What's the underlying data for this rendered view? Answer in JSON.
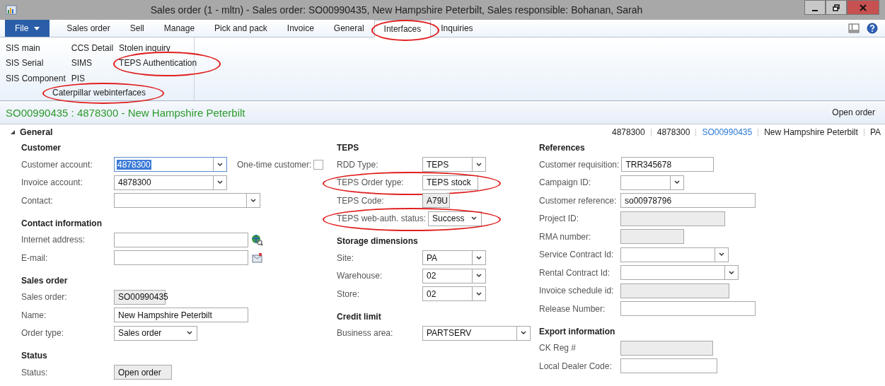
{
  "window": {
    "title": "Sales order (1 - mltn) - Sales order: SO00990435, New Hampshire Peterbilt, Sales responsible: Bohanan, Sarah"
  },
  "file_menu": {
    "label": "File"
  },
  "tabs": [
    {
      "label": "Sales order",
      "selected": false,
      "circled": false
    },
    {
      "label": "Sell",
      "selected": false,
      "circled": false
    },
    {
      "label": "Manage",
      "selected": false,
      "circled": false
    },
    {
      "label": "Pick and pack",
      "selected": false,
      "circled": false
    },
    {
      "label": "Invoice",
      "selected": false,
      "circled": false
    },
    {
      "label": "General",
      "selected": false,
      "circled": false
    },
    {
      "label": "Interfaces",
      "selected": true,
      "circled": true
    },
    {
      "label": "Inquiries",
      "selected": false,
      "circled": false
    }
  ],
  "ribbon": {
    "columns": [
      [
        {
          "label": "SIS main",
          "circled": false
        },
        {
          "label": "SIS Serial",
          "circled": false
        },
        {
          "label": "SIS Component",
          "circled": false
        }
      ],
      [
        {
          "label": "CCS Detail",
          "circled": false
        },
        {
          "label": "SIMS",
          "circled": false
        },
        {
          "label": "PIS",
          "circled": false
        }
      ],
      [
        {
          "label": "Stolen inquiry",
          "circled": false
        },
        {
          "label": "TEPS Authentication",
          "circled": true
        }
      ]
    ],
    "group_label": {
      "label": "Caterpillar webinterfaces",
      "circled": true
    }
  },
  "header": {
    "title": "SO00990435 : 4878300 - New Hampshire Peterbilt",
    "status": "Open order"
  },
  "fasttab": {
    "title": "General",
    "expanded": true,
    "summary": [
      {
        "text": "4878300",
        "kind": "plain"
      },
      {
        "text": "4878300",
        "kind": "plain"
      },
      {
        "text": "SO00990435",
        "kind": "link"
      },
      {
        "text": "New Hampshire Peterbilt",
        "kind": "plain"
      },
      {
        "text": "PA",
        "kind": "plain"
      }
    ]
  },
  "columns": [
    [
      {
        "title": "Customer",
        "fields": [
          {
            "label": "Customer account:",
            "kind": "combo",
            "value": "4878300",
            "focused": true,
            "circled": false,
            "extra": {
              "label": "One-time customer:",
              "checked": false
            }
          },
          {
            "label": "Invoice account:",
            "kind": "combo",
            "value": "4878300",
            "focused": false,
            "circled": false
          },
          {
            "label": "Contact:",
            "kind": "combo",
            "focused": false,
            "circled": false
          }
        ]
      },
      {
        "title": "Contact information",
        "fields": [
          {
            "label": "Internet address:",
            "kind": "weblink",
            "focused": false,
            "circled": false
          },
          {
            "label": "E-mail:",
            "kind": "email",
            "focused": false,
            "circled": false
          }
        ]
      },
      {
        "title": "Sales order",
        "fields": [
          {
            "label": "Sales order:",
            "kind": "readonly",
            "value": "SO00990435",
            "focused": false,
            "circled": false
          },
          {
            "label": "Name:",
            "kind": "text",
            "value": "New Hampshire Peterbilt",
            "focused": false,
            "circled": false
          },
          {
            "label": "Order type:",
            "kind": "select",
            "value": "Sales order",
            "focused": false,
            "circled": false
          }
        ]
      },
      {
        "title": "Status",
        "fields": [
          {
            "label": "Status:",
            "kind": "readonly",
            "value": "Open order",
            "focused": false,
            "circled": false
          }
        ]
      }
    ],
    [
      {
        "title": "TEPS",
        "fields": [
          {
            "label": "RDD Type:",
            "kind": "combo",
            "value": "TEPS",
            "focused": false,
            "circled": false
          },
          {
            "label": "TEPS Order type:",
            "kind": "select",
            "value": "TEPS stock",
            "focused": false,
            "circled": true
          },
          {
            "label": "TEPS Code:",
            "kind": "readonly",
            "value": "A79U",
            "focused": false,
            "circled": false
          },
          {
            "label": "TEPS web-auth. status:",
            "kind": "select",
            "value": "Success",
            "focused": false,
            "circled": true
          }
        ]
      },
      {
        "title": "Storage dimensions",
        "fields": [
          {
            "label": "Site:",
            "kind": "combo",
            "value": "PA",
            "focused": false,
            "circled": false
          },
          {
            "label": "Warehouse:",
            "kind": "combo",
            "value": "02",
            "focused": false,
            "circled": false
          },
          {
            "label": "Store:",
            "kind": "combo",
            "value": "02",
            "focused": false,
            "circled": false
          }
        ]
      },
      {
        "title": "Credit limit",
        "fields": [
          {
            "label": "Business area:",
            "kind": "combo",
            "value": "PARTSERV",
            "focused": false,
            "circled": false
          }
        ]
      }
    ],
    [
      {
        "title": "References",
        "fields": [
          {
            "label": "Customer requisition:",
            "kind": "text",
            "value": "TRR345678",
            "focused": false,
            "circled": false
          },
          {
            "label": "Campaign ID:",
            "kind": "combo",
            "focused": false,
            "circled": false
          },
          {
            "label": "Customer reference:",
            "kind": "text",
            "value": "so00978796",
            "focused": false,
            "circled": false
          },
          {
            "label": "Project ID:",
            "kind": "readonly",
            "focused": false,
            "circled": false
          },
          {
            "label": "RMA number:",
            "kind": "readonly",
            "focused": false,
            "circled": false
          },
          {
            "label": "Service Contract Id:",
            "kind": "combo",
            "focused": false,
            "circled": false
          },
          {
            "label": "Rental Contract Id:",
            "kind": "combo",
            "focused": false,
            "circled": false
          },
          {
            "label": "Invoice schedule id:",
            "kind": "readonly",
            "focused": false,
            "circled": false
          },
          {
            "label": "Release Number:",
            "kind": "text",
            "focused": false,
            "circled": false
          }
        ]
      },
      {
        "title": "Export information",
        "fields": [
          {
            "label": "CK Reg #",
            "kind": "readonly",
            "focused": false,
            "circled": false
          },
          {
            "label": "Local Dealer Code:",
            "kind": "text",
            "focused": false,
            "circled": false
          }
        ]
      }
    ]
  ]
}
